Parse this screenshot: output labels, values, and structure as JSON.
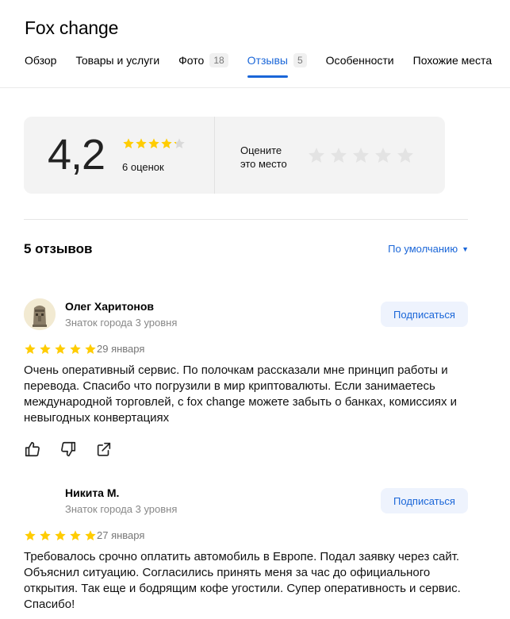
{
  "place": {
    "title": "Fox change"
  },
  "tabs": [
    {
      "label": "Обзор",
      "badge": null,
      "active": false
    },
    {
      "label": "Товары и услуги",
      "badge": null,
      "active": false
    },
    {
      "label": "Фото",
      "badge": "18",
      "active": false
    },
    {
      "label": "Отзывы",
      "badge": "5",
      "active": true
    },
    {
      "label": "Особенности",
      "badge": null,
      "active": false
    },
    {
      "label": "Похожие места",
      "badge": null,
      "active": false
    }
  ],
  "rating": {
    "value": "4,2",
    "score": 4.2,
    "count_label": "6 оценок",
    "rate_prompt": "Оцените\nэто место"
  },
  "reviews_header": {
    "count_label": "5 отзывов",
    "sort_label": "По умолчанию"
  },
  "reviews": [
    {
      "author": "Олег Харитонов",
      "level": "Знаток города 3 уровня",
      "subscribe_label": "Подписаться",
      "stars": 5,
      "date": "29 января",
      "text": "Очень оперативный сервис. По полочкам рассказали мне принцип работы и перевода. Спасибо что погрузили в мир криптовалюты. Если занимаетесь международной торговлей, с fox change можете забыть о банках, комиссиях и невыгодных конвертациях"
    },
    {
      "author": "Никита М.",
      "level": "Знаток города 3 уровня",
      "subscribe_label": "Подписаться",
      "stars": 5,
      "date": "27 января",
      "text": "Требовалось срочно оплатить автомобиль в Европе. Подал заявку через сайт. Объяснил ситуацию. Согласились принять меня за час до официального открытия. Так еще и бодрящим кофе угостили. Супер оперативность и сервис. Спасибо!"
    }
  ],
  "colors": {
    "accent": "#1a66d8",
    "star_filled": "#fc0",
    "star_empty": "#d9d9d9",
    "card_bg": "#f3f3f3"
  },
  "icons": {
    "rating_star": "star-icon",
    "like": "thumb-up-icon",
    "dislike": "thumb-down-icon",
    "share": "share-icon",
    "sort": "caret-down-icon"
  }
}
